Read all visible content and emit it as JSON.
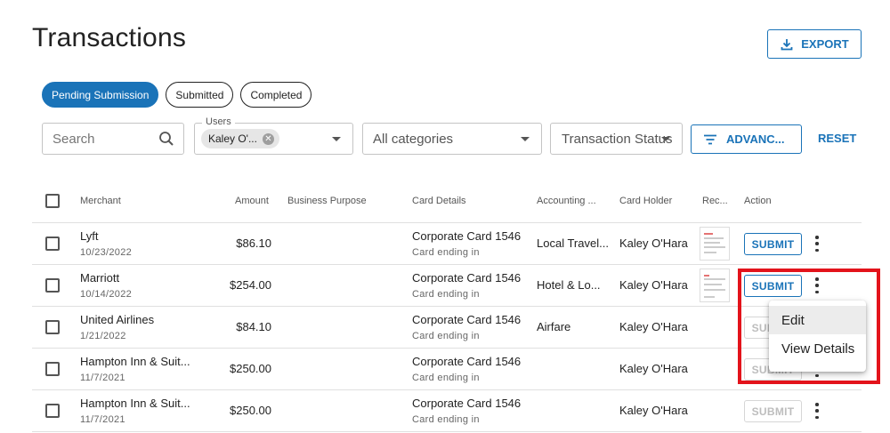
{
  "page_title": "Transactions",
  "export_label": "EXPORT",
  "tabs": [
    {
      "label": "Pending Submission",
      "active": true
    },
    {
      "label": "Submitted",
      "active": false
    },
    {
      "label": "Completed",
      "active": false
    }
  ],
  "filters": {
    "search_placeholder": "Search",
    "users_label": "Users",
    "users_chip": "Kaley O'...",
    "categories_placeholder": "All categories",
    "status_placeholder": "Transaction Status",
    "advanced_label": "ADVANC...",
    "reset_label": "RESET"
  },
  "columns": {
    "merchant": "Merchant",
    "amount": "Amount",
    "business_purpose": "Business Purpose",
    "card_details": "Card Details",
    "accounting": "Accounting ...",
    "card_holder": "Card Holder",
    "receipt": "Rec...",
    "action": "Action"
  },
  "rows": [
    {
      "merchant": "Lyft",
      "date": "10/23/2022",
      "amount": "$86.10",
      "card": "Corporate Card 1546",
      "card_sub": "Card ending in",
      "accounting": "Local Travel...",
      "holder": "Kaley O'Hara",
      "has_receipt": true,
      "submit": "SUBMIT",
      "submit_enabled": true
    },
    {
      "merchant": "Marriott",
      "date": "10/14/2022",
      "amount": "$254.00",
      "card": "Corporate Card 1546",
      "card_sub": "Card ending in",
      "accounting": "Hotel & Lo...",
      "holder": "Kaley O'Hara",
      "has_receipt": true,
      "submit": "SUBMIT",
      "submit_enabled": true
    },
    {
      "merchant": "United Airlines",
      "date": "1/21/2022",
      "amount": "$84.10",
      "card": "Corporate Card 1546",
      "card_sub": "Card ending in",
      "accounting": "Airfare",
      "holder": "Kaley O'Hara",
      "has_receipt": false,
      "submit": "SUBMIT",
      "submit_enabled": false
    },
    {
      "merchant": "Hampton Inn & Suit...",
      "date": "11/7/2021",
      "amount": "$250.00",
      "card": "Corporate Card 1546",
      "card_sub": "Card ending in",
      "accounting": "",
      "holder": "Kaley O'Hara",
      "has_receipt": false,
      "submit": "SUBMIT",
      "submit_enabled": false
    },
    {
      "merchant": "Hampton Inn & Suit...",
      "date": "11/7/2021",
      "amount": "$250.00",
      "card": "Corporate Card 1546",
      "card_sub": "Card ending in",
      "accounting": "",
      "holder": "Kaley O'Hara",
      "has_receipt": false,
      "submit": "SUBMIT",
      "submit_enabled": false
    }
  ],
  "context_menu": {
    "items": [
      "Edit",
      "View Details"
    ]
  },
  "colors": {
    "accent": "#1a73b8",
    "highlight": "#e3131b"
  }
}
